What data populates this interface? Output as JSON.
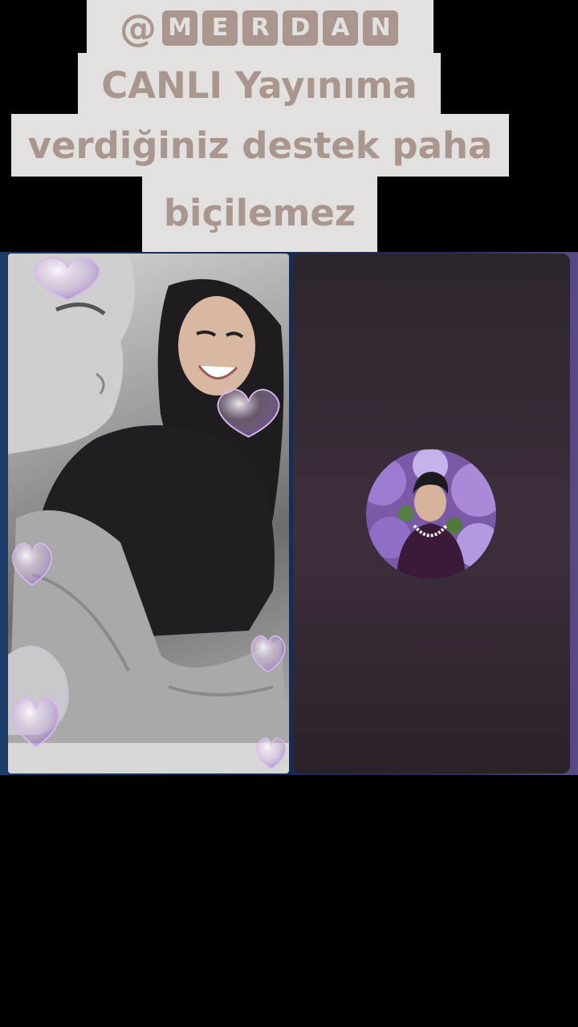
{
  "caption": {
    "handle_prefix": "@",
    "handle_letters": [
      "M",
      "E",
      "R",
      "D",
      "A",
      "N"
    ],
    "line1": "CANLI Yayınıma",
    "line2": "verdiğiniz destek paha",
    "line3": "biçilemez"
  },
  "colors": {
    "caption_bg": "#e3e1df",
    "caption_text": "#a8968f",
    "right_tile_bg": "#2d252d",
    "stage_edge": "#1b3c68"
  },
  "icons": {
    "decorations": [
      "heart-bubble-icon"
    ]
  }
}
